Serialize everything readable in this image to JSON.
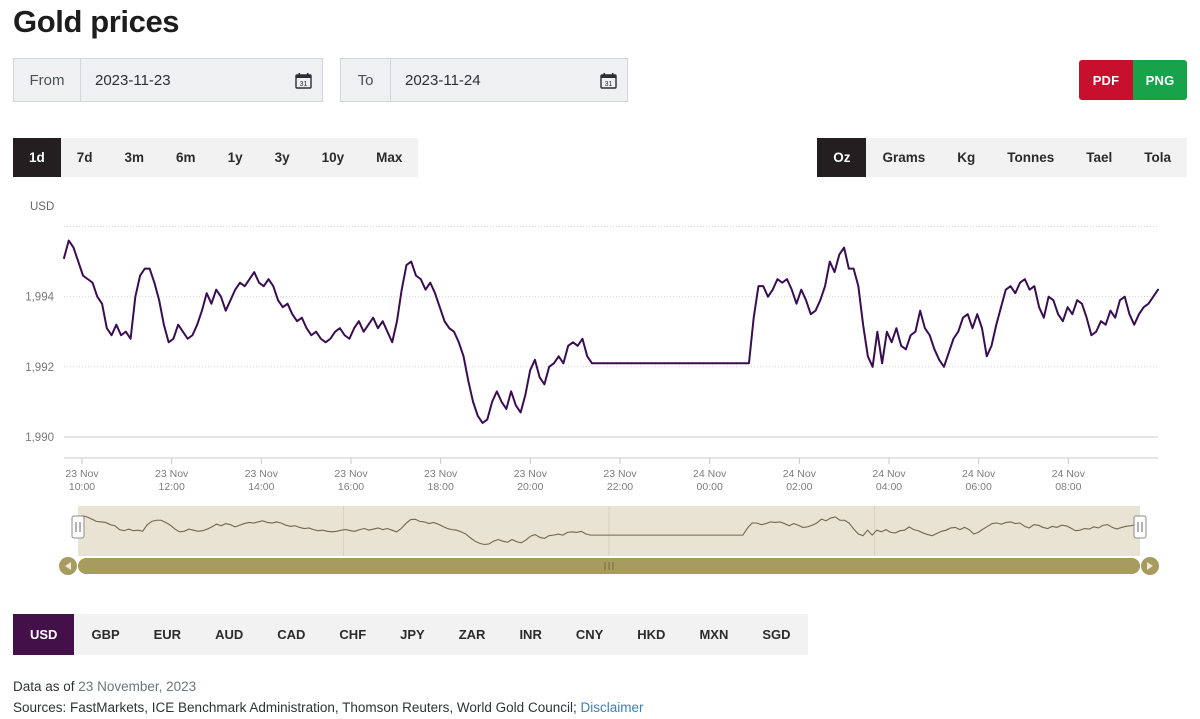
{
  "header": {
    "title": "Gold prices"
  },
  "date_range": {
    "from": {
      "label": "From",
      "value": "2023-11-23",
      "icon": "calendar-icon"
    },
    "to": {
      "label": "To",
      "value": "2023-11-24",
      "icon": "calendar-icon"
    }
  },
  "export": {
    "pdf_label": "PDF",
    "png_label": "PNG",
    "pdf_color": "#c8102e",
    "png_color": "#16a34a"
  },
  "range_tabs": {
    "active": "1d",
    "items": [
      {
        "label": "1d"
      },
      {
        "label": "7d"
      },
      {
        "label": "3m"
      },
      {
        "label": "6m"
      },
      {
        "label": "1y"
      },
      {
        "label": "3y"
      },
      {
        "label": "10y"
      },
      {
        "label": "Max"
      }
    ]
  },
  "unit_tabs": {
    "active": "Oz",
    "items": [
      {
        "label": "Oz"
      },
      {
        "label": "Grams"
      },
      {
        "label": "Kg"
      },
      {
        "label": "Tonnes"
      },
      {
        "label": "Tael"
      },
      {
        "label": "Tola"
      }
    ]
  },
  "currency_tabs": {
    "active": "USD",
    "items": [
      {
        "label": "USD"
      },
      {
        "label": "GBP"
      },
      {
        "label": "EUR"
      },
      {
        "label": "AUD"
      },
      {
        "label": "CAD"
      },
      {
        "label": "CHF"
      },
      {
        "label": "JPY"
      },
      {
        "label": "ZAR"
      },
      {
        "label": "INR"
      },
      {
        "label": "CNY"
      },
      {
        "label": "HKD"
      },
      {
        "label": "MXN"
      },
      {
        "label": "SGD"
      }
    ]
  },
  "footer": {
    "data_as_of_prefix": "Data as of ",
    "data_as_of_date": "23 November, 2023",
    "sources_text": "Sources: FastMarkets, ICE Benchmark Administration, Thomson Reuters, World Gold Council; ",
    "disclaimer_label": "Disclaimer"
  },
  "chart_data": {
    "type": "line",
    "title": "Gold prices",
    "xlabel": "",
    "ylabel": "USD",
    "unit_label": "USD",
    "line_color": "#3a0d52",
    "grid": true,
    "legend": "none",
    "ylim": [
      1989.4,
      1996.3
    ],
    "yticks": [
      1990,
      1992,
      1994,
      1996
    ],
    "ytick_labels": [
      "1,990",
      "1,992",
      "1,994",
      ""
    ],
    "xticks": [
      "23 Nov 10:00",
      "23 Nov 12:00",
      "23 Nov 14:00",
      "23 Nov 16:00",
      "23 Nov 18:00",
      "23 Nov 20:00",
      "23 Nov 22:00",
      "24 Nov 00:00",
      "24 Nov 02:00",
      "24 Nov 04:00",
      "24 Nov 06:00",
      "24 Nov 08:00"
    ],
    "xtick_labels_top": [
      "23 Nov",
      "23 Nov",
      "23 Nov",
      "23 Nov",
      "23 Nov",
      "23 Nov",
      "23 Nov",
      "24 Nov",
      "24 Nov",
      "24 Nov",
      "24 Nov",
      "24 Nov"
    ],
    "xtick_labels_bottom": [
      "10:00",
      "12:00",
      "14:00",
      "16:00",
      "18:00",
      "20:00",
      "22:00",
      "00:00",
      "02:00",
      "04:00",
      "06:00",
      "08:00"
    ],
    "x_start": "23 Nov 09:20",
    "x_end": "24 Nov 08:55",
    "values": [
      1995.1,
      1995.6,
      1995.4,
      1995.0,
      1994.6,
      1994.5,
      1994.4,
      1994.0,
      1993.8,
      1993.1,
      1992.9,
      1993.2,
      1992.9,
      1993.0,
      1992.8,
      1994.0,
      1994.6,
      1994.8,
      1994.8,
      1994.4,
      1993.9,
      1993.2,
      1992.7,
      1992.8,
      1993.2,
      1993.0,
      1992.8,
      1992.9,
      1993.2,
      1993.6,
      1994.1,
      1993.8,
      1994.2,
      1994.0,
      1993.6,
      1993.9,
      1994.2,
      1994.4,
      1994.3,
      1994.5,
      1994.7,
      1994.4,
      1994.3,
      1994.5,
      1994.3,
      1993.9,
      1993.7,
      1993.8,
      1993.5,
      1993.3,
      1993.4,
      1993.1,
      1992.9,
      1993.0,
      1992.8,
      1992.7,
      1992.8,
      1993.0,
      1993.1,
      1992.9,
      1992.8,
      1993.1,
      1993.3,
      1993.0,
      1993.2,
      1993.4,
      1993.1,
      1993.3,
      1993.0,
      1992.7,
      1993.3,
      1994.2,
      1994.9,
      1995.0,
      1994.6,
      1994.5,
      1994.2,
      1994.4,
      1994.1,
      1993.7,
      1993.3,
      1993.1,
      1993.0,
      1992.7,
      1992.3,
      1991.6,
      1991.0,
      1990.6,
      1990.4,
      1990.5,
      1991.0,
      1991.3,
      1991.0,
      1990.8,
      1991.3,
      1990.9,
      1990.7,
      1991.2,
      1991.9,
      1992.2,
      1991.7,
      1991.5,
      1992.0,
      1992.1,
      1992.3,
      1992.1,
      1992.6,
      1992.7,
      1992.6,
      1992.8,
      1992.3,
      1992.1,
      1992.1,
      1992.1,
      1992.1,
      1992.1,
      1992.1,
      1992.1,
      1992.1,
      1992.1,
      1992.1,
      1992.1,
      1992.1,
      1992.1,
      1992.1,
      1992.1,
      1992.1,
      1992.1,
      1992.1,
      1992.1,
      1992.1,
      1992.1,
      1992.1,
      1992.1,
      1992.1,
      1992.1,
      1992.1,
      1992.1,
      1992.1,
      1992.1,
      1992.1,
      1992.1,
      1992.1,
      1992.1,
      1992.1,
      1993.4,
      1994.3,
      1994.3,
      1994.0,
      1994.2,
      1994.5,
      1994.4,
      1994.5,
      1994.2,
      1993.8,
      1994.2,
      1993.9,
      1993.5,
      1993.6,
      1993.9,
      1994.3,
      1995.0,
      1994.7,
      1995.2,
      1995.4,
      1994.8,
      1994.8,
      1994.3,
      1993.2,
      1992.3,
      1992.0,
      1993.0,
      1992.1,
      1993.0,
      1992.7,
      1993.1,
      1992.6,
      1992.5,
      1992.9,
      1993.0,
      1993.6,
      1993.1,
      1992.9,
      1992.5,
      1992.2,
      1992.0,
      1992.4,
      1992.8,
      1993.0,
      1993.4,
      1993.5,
      1993.1,
      1993.5,
      1993.1,
      1992.3,
      1992.6,
      1993.2,
      1993.7,
      1994.2,
      1994.3,
      1994.1,
      1994.4,
      1994.5,
      1994.2,
      1994.3,
      1993.7,
      1993.4,
      1994.0,
      1993.9,
      1993.5,
      1993.3,
      1993.7,
      1993.5,
      1993.9,
      1993.8,
      1993.4,
      1992.9,
      1993.0,
      1993.3,
      1993.2,
      1993.6,
      1993.4,
      1993.9,
      1994.0,
      1993.5,
      1993.2,
      1993.5,
      1993.7,
      1993.8,
      1994.0,
      1994.2
    ]
  },
  "navigator": {
    "left_handle": "navigator-left-handle",
    "right_handle": "navigator-right-handle",
    "scroll_left_arrow": "◀",
    "scroll_right_arrow": "▶",
    "track_color": "#e8e2ce",
    "series_color": "#837killed",
    "bar_color": "#a89b5f"
  }
}
